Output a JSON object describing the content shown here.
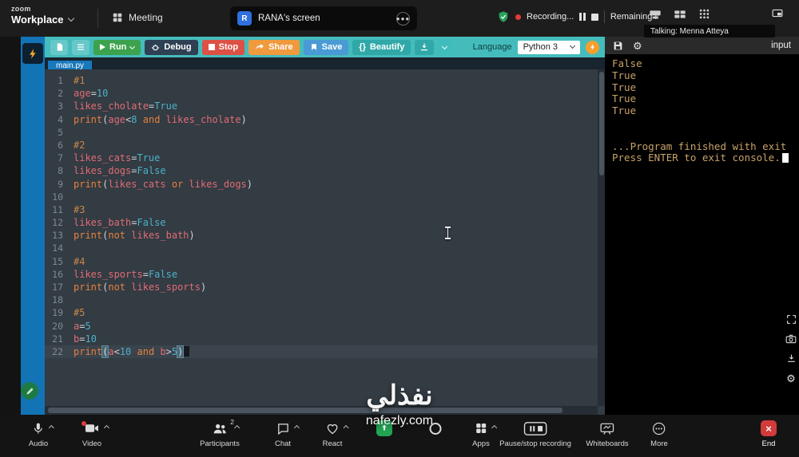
{
  "top_bar": {
    "brand_small": "zoom",
    "brand": "Workplace",
    "meeting_tab": "Meeting",
    "screen_tab": {
      "avatar": "R",
      "label": "RANA's screen"
    },
    "recording": "Recording...",
    "remaining": "Remaining mee...",
    "talking": "Talking: Menna Atteya"
  },
  "ide": {
    "toolbar": {
      "run": "Run",
      "debug": "Debug",
      "stop": "Stop",
      "share": "Share",
      "save": "Save",
      "beautify": "Beautify",
      "braces": "{}",
      "language_label": "Language",
      "language_value": "Python 3"
    },
    "file_tab": "main.py",
    "editor": {
      "active_line": 22,
      "lines": [
        {
          "n": 1,
          "t": [
            [
              "c",
              "#1"
            ]
          ]
        },
        {
          "n": 2,
          "t": [
            [
              "v",
              "age"
            ],
            [
              "o",
              "="
            ],
            [
              "n",
              "10"
            ]
          ]
        },
        {
          "n": 3,
          "t": [
            [
              "v",
              "likes_cholate"
            ],
            [
              "o",
              "="
            ],
            [
              "n",
              "True"
            ]
          ]
        },
        {
          "n": 4,
          "t": [
            [
              "k",
              "print"
            ],
            [
              "o",
              "("
            ],
            [
              "v",
              "age"
            ],
            [
              "o",
              "<"
            ],
            [
              "n",
              "8"
            ],
            [
              "o",
              " "
            ],
            [
              "k",
              "and"
            ],
            [
              "o",
              " "
            ],
            [
              "v",
              "likes_cholate"
            ],
            [
              "o",
              ")"
            ]
          ]
        },
        {
          "n": 5,
          "t": []
        },
        {
          "n": 6,
          "t": [
            [
              "c",
              "#2"
            ]
          ]
        },
        {
          "n": 7,
          "t": [
            [
              "v",
              "likes_cats"
            ],
            [
              "o",
              "="
            ],
            [
              "n",
              "True"
            ]
          ]
        },
        {
          "n": 8,
          "t": [
            [
              "v",
              "likes_dogs"
            ],
            [
              "o",
              "="
            ],
            [
              "n",
              "False"
            ]
          ]
        },
        {
          "n": 9,
          "t": [
            [
              "k",
              "print"
            ],
            [
              "o",
              "("
            ],
            [
              "v",
              "likes_cats"
            ],
            [
              "o",
              " "
            ],
            [
              "k",
              "or"
            ],
            [
              "o",
              " "
            ],
            [
              "v",
              "likes_dogs"
            ],
            [
              "o",
              ")"
            ]
          ]
        },
        {
          "n": 10,
          "t": []
        },
        {
          "n": 11,
          "t": [
            [
              "c",
              "#3"
            ]
          ]
        },
        {
          "n": 12,
          "t": [
            [
              "v",
              "likes_bath"
            ],
            [
              "o",
              "="
            ],
            [
              "n",
              "False"
            ]
          ]
        },
        {
          "n": 13,
          "t": [
            [
              "k",
              "print"
            ],
            [
              "o",
              "("
            ],
            [
              "k",
              "not"
            ],
            [
              "o",
              " "
            ],
            [
              "v",
              "likes_bath"
            ],
            [
              "o",
              ")"
            ]
          ]
        },
        {
          "n": 14,
          "t": []
        },
        {
          "n": 15,
          "t": [
            [
              "c",
              "#4"
            ]
          ]
        },
        {
          "n": 16,
          "t": [
            [
              "v",
              "likes_sports"
            ],
            [
              "o",
              "="
            ],
            [
              "n",
              "False"
            ]
          ]
        },
        {
          "n": 17,
          "t": [
            [
              "k",
              "print"
            ],
            [
              "o",
              "("
            ],
            [
              "k",
              "not"
            ],
            [
              "o",
              " "
            ],
            [
              "v",
              "likes_sports"
            ],
            [
              "o",
              ")"
            ]
          ]
        },
        {
          "n": 18,
          "t": []
        },
        {
          "n": 19,
          "t": [
            [
              "c",
              "#5"
            ]
          ]
        },
        {
          "n": 20,
          "t": [
            [
              "v",
              "a"
            ],
            [
              "o",
              "="
            ],
            [
              "n",
              "5"
            ]
          ]
        },
        {
          "n": 21,
          "t": [
            [
              "v",
              "b"
            ],
            [
              "o",
              "="
            ],
            [
              "n",
              "10"
            ]
          ]
        },
        {
          "n": 22,
          "t": [
            [
              "k",
              "print"
            ],
            [
              "m",
              "("
            ],
            [
              "v",
              "a"
            ],
            [
              "o",
              "<"
            ],
            [
              "n",
              "10"
            ],
            [
              "o",
              " "
            ],
            [
              "k",
              "and"
            ],
            [
              "o",
              " "
            ],
            [
              "v",
              "b"
            ],
            [
              "o",
              ">"
            ],
            [
              "n",
              "5"
            ],
            [
              "m",
              ")"
            ]
          ]
        }
      ]
    }
  },
  "console": {
    "input_label": "input",
    "lines": [
      "False",
      "True",
      "True",
      "True",
      "True",
      "",
      "",
      "...Program finished with exit",
      "Press ENTER to exit console."
    ]
  },
  "bottom_bar": {
    "audio": "Audio",
    "video": "Video",
    "participants": "Participants",
    "participants_count": "2",
    "chat": "Chat",
    "react": "React",
    "apps": "Apps",
    "record": "Pause/stop recording",
    "whiteboards": "Whiteboards",
    "more": "More",
    "end": "End"
  },
  "watermark": {
    "title": "نفذلي",
    "subtitle": "nafezly.com"
  }
}
